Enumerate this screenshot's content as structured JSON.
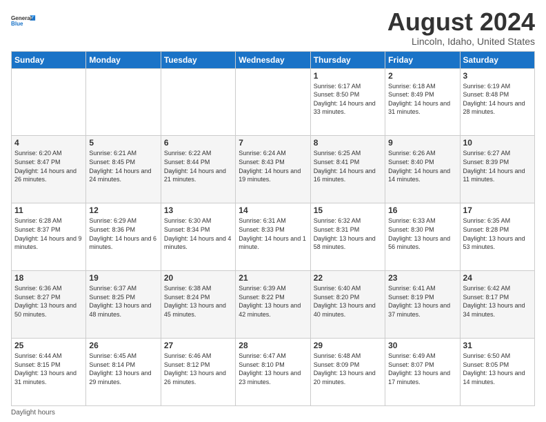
{
  "logo": {
    "line1": "General",
    "line2": "Blue"
  },
  "title": "August 2024",
  "subtitle": "Lincoln, Idaho, United States",
  "days_of_week": [
    "Sunday",
    "Monday",
    "Tuesday",
    "Wednesday",
    "Thursday",
    "Friday",
    "Saturday"
  ],
  "footer": "Daylight hours",
  "weeks": [
    [
      {
        "day": "",
        "info": ""
      },
      {
        "day": "",
        "info": ""
      },
      {
        "day": "",
        "info": ""
      },
      {
        "day": "",
        "info": ""
      },
      {
        "day": "1",
        "info": "Sunrise: 6:17 AM\nSunset: 8:50 PM\nDaylight: 14 hours\nand 33 minutes."
      },
      {
        "day": "2",
        "info": "Sunrise: 6:18 AM\nSunset: 8:49 PM\nDaylight: 14 hours\nand 31 minutes."
      },
      {
        "day": "3",
        "info": "Sunrise: 6:19 AM\nSunset: 8:48 PM\nDaylight: 14 hours\nand 28 minutes."
      }
    ],
    [
      {
        "day": "4",
        "info": "Sunrise: 6:20 AM\nSunset: 8:47 PM\nDaylight: 14 hours\nand 26 minutes."
      },
      {
        "day": "5",
        "info": "Sunrise: 6:21 AM\nSunset: 8:45 PM\nDaylight: 14 hours\nand 24 minutes."
      },
      {
        "day": "6",
        "info": "Sunrise: 6:22 AM\nSunset: 8:44 PM\nDaylight: 14 hours\nand 21 minutes."
      },
      {
        "day": "7",
        "info": "Sunrise: 6:24 AM\nSunset: 8:43 PM\nDaylight: 14 hours\nand 19 minutes."
      },
      {
        "day": "8",
        "info": "Sunrise: 6:25 AM\nSunset: 8:41 PM\nDaylight: 14 hours\nand 16 minutes."
      },
      {
        "day": "9",
        "info": "Sunrise: 6:26 AM\nSunset: 8:40 PM\nDaylight: 14 hours\nand 14 minutes."
      },
      {
        "day": "10",
        "info": "Sunrise: 6:27 AM\nSunset: 8:39 PM\nDaylight: 14 hours\nand 11 minutes."
      }
    ],
    [
      {
        "day": "11",
        "info": "Sunrise: 6:28 AM\nSunset: 8:37 PM\nDaylight: 14 hours\nand 9 minutes."
      },
      {
        "day": "12",
        "info": "Sunrise: 6:29 AM\nSunset: 8:36 PM\nDaylight: 14 hours\nand 6 minutes."
      },
      {
        "day": "13",
        "info": "Sunrise: 6:30 AM\nSunset: 8:34 PM\nDaylight: 14 hours\nand 4 minutes."
      },
      {
        "day": "14",
        "info": "Sunrise: 6:31 AM\nSunset: 8:33 PM\nDaylight: 14 hours\nand 1 minute."
      },
      {
        "day": "15",
        "info": "Sunrise: 6:32 AM\nSunset: 8:31 PM\nDaylight: 13 hours\nand 58 minutes."
      },
      {
        "day": "16",
        "info": "Sunrise: 6:33 AM\nSunset: 8:30 PM\nDaylight: 13 hours\nand 56 minutes."
      },
      {
        "day": "17",
        "info": "Sunrise: 6:35 AM\nSunset: 8:28 PM\nDaylight: 13 hours\nand 53 minutes."
      }
    ],
    [
      {
        "day": "18",
        "info": "Sunrise: 6:36 AM\nSunset: 8:27 PM\nDaylight: 13 hours\nand 50 minutes."
      },
      {
        "day": "19",
        "info": "Sunrise: 6:37 AM\nSunset: 8:25 PM\nDaylight: 13 hours\nand 48 minutes."
      },
      {
        "day": "20",
        "info": "Sunrise: 6:38 AM\nSunset: 8:24 PM\nDaylight: 13 hours\nand 45 minutes."
      },
      {
        "day": "21",
        "info": "Sunrise: 6:39 AM\nSunset: 8:22 PM\nDaylight: 13 hours\nand 42 minutes."
      },
      {
        "day": "22",
        "info": "Sunrise: 6:40 AM\nSunset: 8:20 PM\nDaylight: 13 hours\nand 40 minutes."
      },
      {
        "day": "23",
        "info": "Sunrise: 6:41 AM\nSunset: 8:19 PM\nDaylight: 13 hours\nand 37 minutes."
      },
      {
        "day": "24",
        "info": "Sunrise: 6:42 AM\nSunset: 8:17 PM\nDaylight: 13 hours\nand 34 minutes."
      }
    ],
    [
      {
        "day": "25",
        "info": "Sunrise: 6:44 AM\nSunset: 8:15 PM\nDaylight: 13 hours\nand 31 minutes."
      },
      {
        "day": "26",
        "info": "Sunrise: 6:45 AM\nSunset: 8:14 PM\nDaylight: 13 hours\nand 29 minutes."
      },
      {
        "day": "27",
        "info": "Sunrise: 6:46 AM\nSunset: 8:12 PM\nDaylight: 13 hours\nand 26 minutes."
      },
      {
        "day": "28",
        "info": "Sunrise: 6:47 AM\nSunset: 8:10 PM\nDaylight: 13 hours\nand 23 minutes."
      },
      {
        "day": "29",
        "info": "Sunrise: 6:48 AM\nSunset: 8:09 PM\nDaylight: 13 hours\nand 20 minutes."
      },
      {
        "day": "30",
        "info": "Sunrise: 6:49 AM\nSunset: 8:07 PM\nDaylight: 13 hours\nand 17 minutes."
      },
      {
        "day": "31",
        "info": "Sunrise: 6:50 AM\nSunset: 8:05 PM\nDaylight: 13 hours\nand 14 minutes."
      }
    ]
  ]
}
